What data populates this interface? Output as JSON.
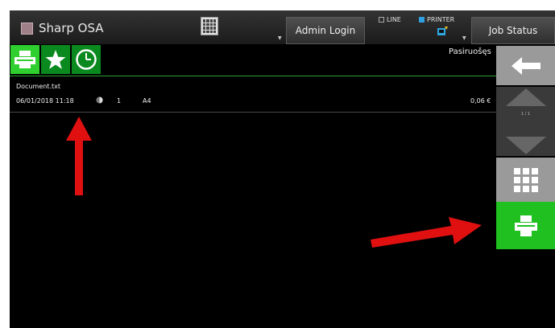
{
  "header": {
    "app_title": "Sharp OSA",
    "admin_login_label": "Admin Login",
    "line_label": "LINE",
    "printer_label": "PRINTER",
    "job_status_label": "Job Status"
  },
  "tabs": [
    {
      "icon": "printer-icon",
      "active": true
    },
    {
      "icon": "star-icon",
      "active": false
    },
    {
      "icon": "clock-icon",
      "active": false
    }
  ],
  "status_text": "Pasiruošęs",
  "document": {
    "name": "Document.txt",
    "datetime": "06/01/2018 11:18",
    "color_mode_icon": "color-mode-icon",
    "copies": "1",
    "paper": "A4",
    "price": "0,06 €"
  },
  "pagination": "1 / 1",
  "colors": {
    "green_dark": "#0a8a1e",
    "green_active": "#2fcf2f",
    "gray_button": "#9a9a9a",
    "annotation_arrow": "#e01010"
  }
}
